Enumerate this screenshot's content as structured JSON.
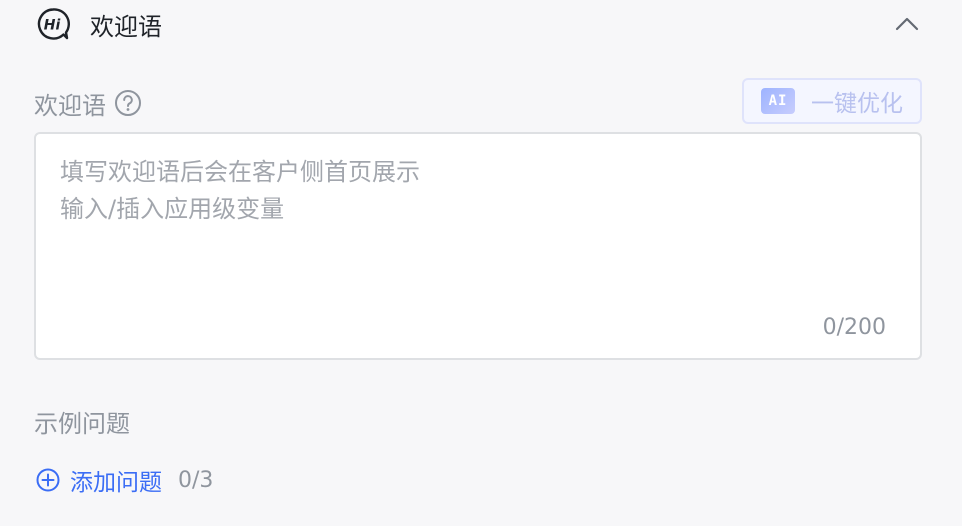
{
  "header": {
    "icon": "hi-chat-icon",
    "icon_text": "Hi",
    "title": "欢迎语",
    "collapse_icon": "chevron-up-icon"
  },
  "welcome": {
    "label": "欢迎语",
    "help_icon": "question-circle-icon",
    "ai_button": {
      "badge": "AI",
      "label": "一键优化"
    },
    "placeholder_line1": "填写欢迎语后会在客户侧首页展示",
    "placeholder_line2": "输入/插入应用级变量",
    "counter": "0/200"
  },
  "examples": {
    "title": "示例问题",
    "add_icon": "plus-circle-icon",
    "add_label": "添加问题",
    "count": "0/3"
  },
  "colors": {
    "accent": "#3b6df5",
    "muted_text": "#8f959e",
    "placeholder": "#a2a6ad",
    "background": "#f7f7f9"
  }
}
